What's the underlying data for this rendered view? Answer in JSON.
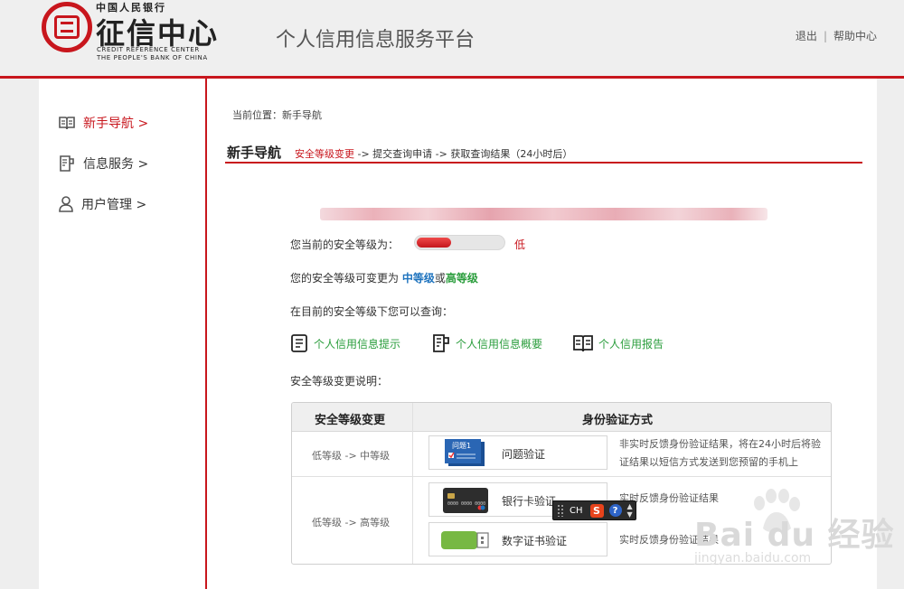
{
  "header": {
    "logo_top": "中国人民银行",
    "logo_main": "征信中心",
    "logo_en_line1": "CREDIT REFERENCE CENTER",
    "logo_en_line2": "THE PEOPLE'S BANK OF CHINA",
    "platform_title": "个人信用信息服务平台",
    "logout": "退出",
    "separator": "|",
    "help": "帮助中心"
  },
  "sidebar": {
    "items": [
      {
        "label": "新手导航 >",
        "icon": "book-icon",
        "active": true
      },
      {
        "label": "信息服务 >",
        "icon": "document-icon",
        "active": false
      },
      {
        "label": "用户管理 >",
        "icon": "user-icon",
        "active": false
      }
    ]
  },
  "main": {
    "breadcrumb": "当前位置：新手导航",
    "title": "新手导航",
    "steps": {
      "current": "安全等级变更",
      "rest": " -> 提交查询申请 -> 获取查询结果（24小时后）"
    },
    "security": {
      "label": "您当前的安全等级为：",
      "level": "低",
      "level_fraction": 0.4,
      "change_prefix": "您的安全等级可变更为 ",
      "medium": "中等级",
      "or": "或",
      "high": "高等级",
      "query_intro": "在目前的安全等级下您可以查询："
    },
    "query_links": [
      {
        "label": "个人信用信息提示",
        "icon": "list-document-icon"
      },
      {
        "label": "个人信用信息概要",
        "icon": "document-icon"
      },
      {
        "label": "个人信用报告",
        "icon": "book-icon"
      }
    ],
    "explain_title": "安全等级变更说明：",
    "table": {
      "headers": [
        "安全等级变更",
        "身份验证方式"
      ],
      "rows": [
        {
          "change": "低等级 -> 中等级",
          "methods": [
            {
              "label": "问题验证",
              "badge": "问题1",
              "desc": "非实时反馈身份验证结果，将在24小时后将验证结果以短信方式发送到您预留的手机上"
            }
          ]
        },
        {
          "change": "低等级 -> 高等级",
          "methods": [
            {
              "label": "银行卡验证",
              "desc": "实时反馈身份验证结果"
            },
            {
              "label": "数字证书验证",
              "desc": "实时反馈身份验证结果"
            }
          ]
        }
      ]
    }
  },
  "ime_toolbar": {
    "lang": "CH",
    "logo": "S",
    "help": "?"
  },
  "watermark": {
    "text": "Bai du 经验",
    "url": "jingyan.baidu.com"
  },
  "colors": {
    "brand_red": "#c8161d",
    "link_green": "#2a9d3c",
    "link_blue": "#1e73be"
  }
}
